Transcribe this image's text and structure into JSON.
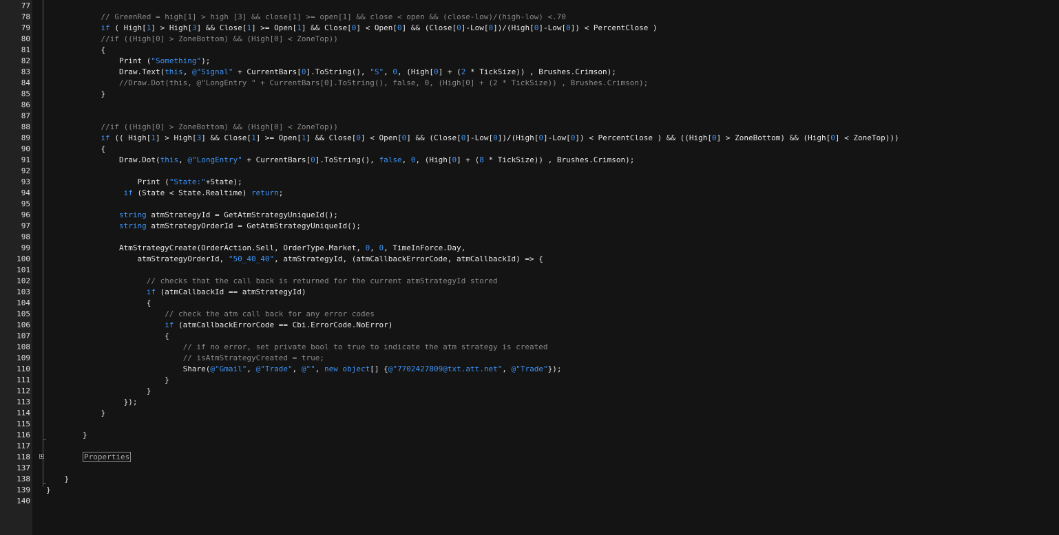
{
  "editor": {
    "lines": [
      {
        "n": "77",
        "segs": []
      },
      {
        "n": "78",
        "segs": [
          {
            "t": "            ",
            "c": "p"
          },
          {
            "t": "// GreenRed = high[1] > high [3] && close[1] >= open[1] && close < open && (close-low)/(high-low) <.70",
            "c": "cm"
          }
        ]
      },
      {
        "n": "79",
        "segs": [
          {
            "t": "            ",
            "c": "p"
          },
          {
            "t": "if",
            "c": "kw"
          },
          {
            "t": " ( High[",
            "c": "p"
          },
          {
            "t": "1",
            "c": "num"
          },
          {
            "t": "] > High[",
            "c": "p"
          },
          {
            "t": "3",
            "c": "num"
          },
          {
            "t": "] && Close[",
            "c": "p"
          },
          {
            "t": "1",
            "c": "num"
          },
          {
            "t": "] >= Open[",
            "c": "p"
          },
          {
            "t": "1",
            "c": "num"
          },
          {
            "t": "] && Close[",
            "c": "p"
          },
          {
            "t": "0",
            "c": "num"
          },
          {
            "t": "] < Open[",
            "c": "p"
          },
          {
            "t": "0",
            "c": "num"
          },
          {
            "t": "] && (Close[",
            "c": "p"
          },
          {
            "t": "0",
            "c": "num"
          },
          {
            "t": "]-Low[",
            "c": "p"
          },
          {
            "t": "0",
            "c": "num"
          },
          {
            "t": "])/(High[",
            "c": "p"
          },
          {
            "t": "0",
            "c": "num"
          },
          {
            "t": "]-Low[",
            "c": "p"
          },
          {
            "t": "0",
            "c": "num"
          },
          {
            "t": "]) < PercentClose )",
            "c": "p"
          }
        ]
      },
      {
        "n": "80",
        "segs": [
          {
            "t": "            ",
            "c": "p"
          },
          {
            "t": "//if ((High[0] > ZoneBottom) && (High[0] < ZoneTop))",
            "c": "cm"
          }
        ]
      },
      {
        "n": "81",
        "segs": [
          {
            "t": "            {",
            "c": "p"
          }
        ]
      },
      {
        "n": "82",
        "segs": [
          {
            "t": "                Print (",
            "c": "p"
          },
          {
            "t": "\"Something\"",
            "c": "str"
          },
          {
            "t": ");",
            "c": "p"
          }
        ]
      },
      {
        "n": "83",
        "segs": [
          {
            "t": "                Draw.Text(",
            "c": "p"
          },
          {
            "t": "this",
            "c": "kw"
          },
          {
            "t": ", ",
            "c": "p"
          },
          {
            "t": "@\"Signal\"",
            "c": "str"
          },
          {
            "t": " + CurrentBars[",
            "c": "p"
          },
          {
            "t": "0",
            "c": "num"
          },
          {
            "t": "].ToString(), ",
            "c": "p"
          },
          {
            "t": "\"S\"",
            "c": "str"
          },
          {
            "t": ", ",
            "c": "p"
          },
          {
            "t": "0",
            "c": "num"
          },
          {
            "t": ", (High[",
            "c": "p"
          },
          {
            "t": "0",
            "c": "num"
          },
          {
            "t": "] + (",
            "c": "p"
          },
          {
            "t": "2",
            "c": "num"
          },
          {
            "t": " * TickSize)) , Brushes.Crimson);",
            "c": "p"
          }
        ]
      },
      {
        "n": "84",
        "segs": [
          {
            "t": "                ",
            "c": "p"
          },
          {
            "t": "//Draw.Dot(this, @\"LongEntry \" + CurrentBars[0].ToString(), false, 0, (High[0] + (2 * TickSize)) , Brushes.Crimson);",
            "c": "cm"
          }
        ]
      },
      {
        "n": "85",
        "segs": [
          {
            "t": "            }",
            "c": "p"
          }
        ]
      },
      {
        "n": "86",
        "segs": []
      },
      {
        "n": "87",
        "segs": []
      },
      {
        "n": "88",
        "segs": [
          {
            "t": "            ",
            "c": "p"
          },
          {
            "t": "//if ((High[0] > ZoneBottom) && (High[0] < ZoneTop))",
            "c": "cm"
          }
        ]
      },
      {
        "n": "89",
        "segs": [
          {
            "t": "            ",
            "c": "p"
          },
          {
            "t": "if",
            "c": "kw"
          },
          {
            "t": " (( High[",
            "c": "p"
          },
          {
            "t": "1",
            "c": "num"
          },
          {
            "t": "] > High[",
            "c": "p"
          },
          {
            "t": "3",
            "c": "num"
          },
          {
            "t": "] && Close[",
            "c": "p"
          },
          {
            "t": "1",
            "c": "num"
          },
          {
            "t": "] >= Open[",
            "c": "p"
          },
          {
            "t": "1",
            "c": "num"
          },
          {
            "t": "] && Close[",
            "c": "p"
          },
          {
            "t": "0",
            "c": "num"
          },
          {
            "t": "] < Open[",
            "c": "p"
          },
          {
            "t": "0",
            "c": "num"
          },
          {
            "t": "] && (Close[",
            "c": "p"
          },
          {
            "t": "0",
            "c": "num"
          },
          {
            "t": "]-Low[",
            "c": "p"
          },
          {
            "t": "0",
            "c": "num"
          },
          {
            "t": "])/(High[",
            "c": "p"
          },
          {
            "t": "0",
            "c": "num"
          },
          {
            "t": "]-Low[",
            "c": "p"
          },
          {
            "t": "0",
            "c": "num"
          },
          {
            "t": "]) < PercentClose ) && ((High[",
            "c": "p"
          },
          {
            "t": "0",
            "c": "num"
          },
          {
            "t": "] > ZoneBottom) && (High[",
            "c": "p"
          },
          {
            "t": "0",
            "c": "num"
          },
          {
            "t": "] < ZoneTop)))",
            "c": "p"
          }
        ]
      },
      {
        "n": "90",
        "segs": [
          {
            "t": "            {",
            "c": "p"
          }
        ]
      },
      {
        "n": "91",
        "segs": [
          {
            "t": "                Draw.Dot(",
            "c": "p"
          },
          {
            "t": "this",
            "c": "kw"
          },
          {
            "t": ", ",
            "c": "p"
          },
          {
            "t": "@\"LongEntry\"",
            "c": "str"
          },
          {
            "t": " + CurrentBars[",
            "c": "p"
          },
          {
            "t": "0",
            "c": "num"
          },
          {
            "t": "].ToString(), ",
            "c": "p"
          },
          {
            "t": "false",
            "c": "kw"
          },
          {
            "t": ", ",
            "c": "p"
          },
          {
            "t": "0",
            "c": "num"
          },
          {
            "t": ", (High[",
            "c": "p"
          },
          {
            "t": "0",
            "c": "num"
          },
          {
            "t": "] + (",
            "c": "p"
          },
          {
            "t": "8",
            "c": "num"
          },
          {
            "t": " * TickSize)) , Brushes.Crimson);",
            "c": "p"
          }
        ]
      },
      {
        "n": "92",
        "segs": []
      },
      {
        "n": "93",
        "segs": [
          {
            "t": "                    Print (",
            "c": "p"
          },
          {
            "t": "\"State:\"",
            "c": "str"
          },
          {
            "t": "+State);",
            "c": "p"
          }
        ]
      },
      {
        "n": "94",
        "segs": [
          {
            "t": "                 ",
            "c": "p"
          },
          {
            "t": "if",
            "c": "kw"
          },
          {
            "t": " (State < State.Realtime) ",
            "c": "p"
          },
          {
            "t": "return",
            "c": "kw"
          },
          {
            "t": ";",
            "c": "p"
          }
        ]
      },
      {
        "n": "95",
        "segs": []
      },
      {
        "n": "96",
        "segs": [
          {
            "t": "                ",
            "c": "p"
          },
          {
            "t": "string",
            "c": "kw"
          },
          {
            "t": " atmStrategyId = GetAtmStrategyUniqueId();",
            "c": "p"
          }
        ]
      },
      {
        "n": "97",
        "segs": [
          {
            "t": "                ",
            "c": "p"
          },
          {
            "t": "string",
            "c": "kw"
          },
          {
            "t": " atmStrategyOrderId = GetAtmStrategyUniqueId();",
            "c": "p"
          }
        ]
      },
      {
        "n": "98",
        "segs": []
      },
      {
        "n": "99",
        "segs": [
          {
            "t": "                AtmStrategyCreate(OrderAction.Sell, OrderType.Market, ",
            "c": "p"
          },
          {
            "t": "0",
            "c": "num"
          },
          {
            "t": ", ",
            "c": "p"
          },
          {
            "t": "0",
            "c": "num"
          },
          {
            "t": ", TimeInForce.Day,",
            "c": "p"
          }
        ]
      },
      {
        "n": "100",
        "segs": [
          {
            "t": "                    atmStrategyOrderId, ",
            "c": "p"
          },
          {
            "t": "\"50_40_40\"",
            "c": "str"
          },
          {
            "t": ", atmStrategyId, (atmCallbackErrorCode, atmCallbackId) => {",
            "c": "p"
          }
        ]
      },
      {
        "n": "101",
        "segs": []
      },
      {
        "n": "102",
        "segs": [
          {
            "t": "                      ",
            "c": "p"
          },
          {
            "t": "// checks that the call back is returned for the current atmStrategyId stored",
            "c": "cm"
          }
        ]
      },
      {
        "n": "103",
        "segs": [
          {
            "t": "                      ",
            "c": "p"
          },
          {
            "t": "if",
            "c": "kw"
          },
          {
            "t": " (atmCallbackId == atmStrategyId)",
            "c": "p"
          }
        ]
      },
      {
        "n": "104",
        "segs": [
          {
            "t": "                      {",
            "c": "p"
          }
        ]
      },
      {
        "n": "105",
        "segs": [
          {
            "t": "                          ",
            "c": "p"
          },
          {
            "t": "// check the atm call back for any error codes",
            "c": "cm"
          }
        ]
      },
      {
        "n": "106",
        "segs": [
          {
            "t": "                          ",
            "c": "p"
          },
          {
            "t": "if",
            "c": "kw"
          },
          {
            "t": " (atmCallbackErrorCode == Cbi.ErrorCode.NoError)",
            "c": "p"
          }
        ]
      },
      {
        "n": "107",
        "segs": [
          {
            "t": "                          {",
            "c": "p"
          }
        ]
      },
      {
        "n": "108",
        "segs": [
          {
            "t": "                              ",
            "c": "p"
          },
          {
            "t": "// if no error, set private bool to true to indicate the atm strategy is created",
            "c": "cm"
          }
        ]
      },
      {
        "n": "109",
        "segs": [
          {
            "t": "                              ",
            "c": "p"
          },
          {
            "t": "// isAtmStrategyCreated = true;",
            "c": "cm"
          }
        ]
      },
      {
        "n": "110",
        "segs": [
          {
            "t": "                              Share(",
            "c": "p"
          },
          {
            "t": "@\"Gmail\"",
            "c": "str"
          },
          {
            "t": ", ",
            "c": "p"
          },
          {
            "t": "@\"Trade\"",
            "c": "str"
          },
          {
            "t": ", ",
            "c": "p"
          },
          {
            "t": "@\"\"",
            "c": "str"
          },
          {
            "t": ", ",
            "c": "p"
          },
          {
            "t": "new",
            "c": "kw"
          },
          {
            "t": " ",
            "c": "p"
          },
          {
            "t": "object",
            "c": "kw"
          },
          {
            "t": "[] {",
            "c": "p"
          },
          {
            "t": "@\"7702427809@txt.att.net\"",
            "c": "str"
          },
          {
            "t": ", ",
            "c": "p"
          },
          {
            "t": "@\"Trade\"",
            "c": "str"
          },
          {
            "t": "});",
            "c": "p"
          }
        ]
      },
      {
        "n": "111",
        "segs": [
          {
            "t": "                          }",
            "c": "p"
          }
        ]
      },
      {
        "n": "112",
        "segs": [
          {
            "t": "                      }",
            "c": "p"
          }
        ]
      },
      {
        "n": "113",
        "segs": [
          {
            "t": "                 });",
            "c": "p"
          }
        ]
      },
      {
        "n": "114",
        "segs": [
          {
            "t": "            }",
            "c": "p"
          }
        ]
      },
      {
        "n": "115",
        "segs": []
      },
      {
        "n": "116",
        "segs": [
          {
            "t": "        }",
            "c": "p"
          }
        ]
      },
      {
        "n": "117",
        "segs": []
      },
      {
        "n": "118",
        "segs": [
          {
            "t": "        ",
            "c": "p"
          },
          {
            "t": "Properties",
            "c": "region"
          }
        ]
      },
      {
        "n": "137",
        "segs": []
      },
      {
        "n": "138",
        "segs": [
          {
            "t": "    }",
            "c": "p"
          }
        ]
      },
      {
        "n": "139",
        "segs": [
          {
            "t": "}",
            "c": "p"
          }
        ]
      },
      {
        "n": "140",
        "segs": []
      }
    ]
  }
}
